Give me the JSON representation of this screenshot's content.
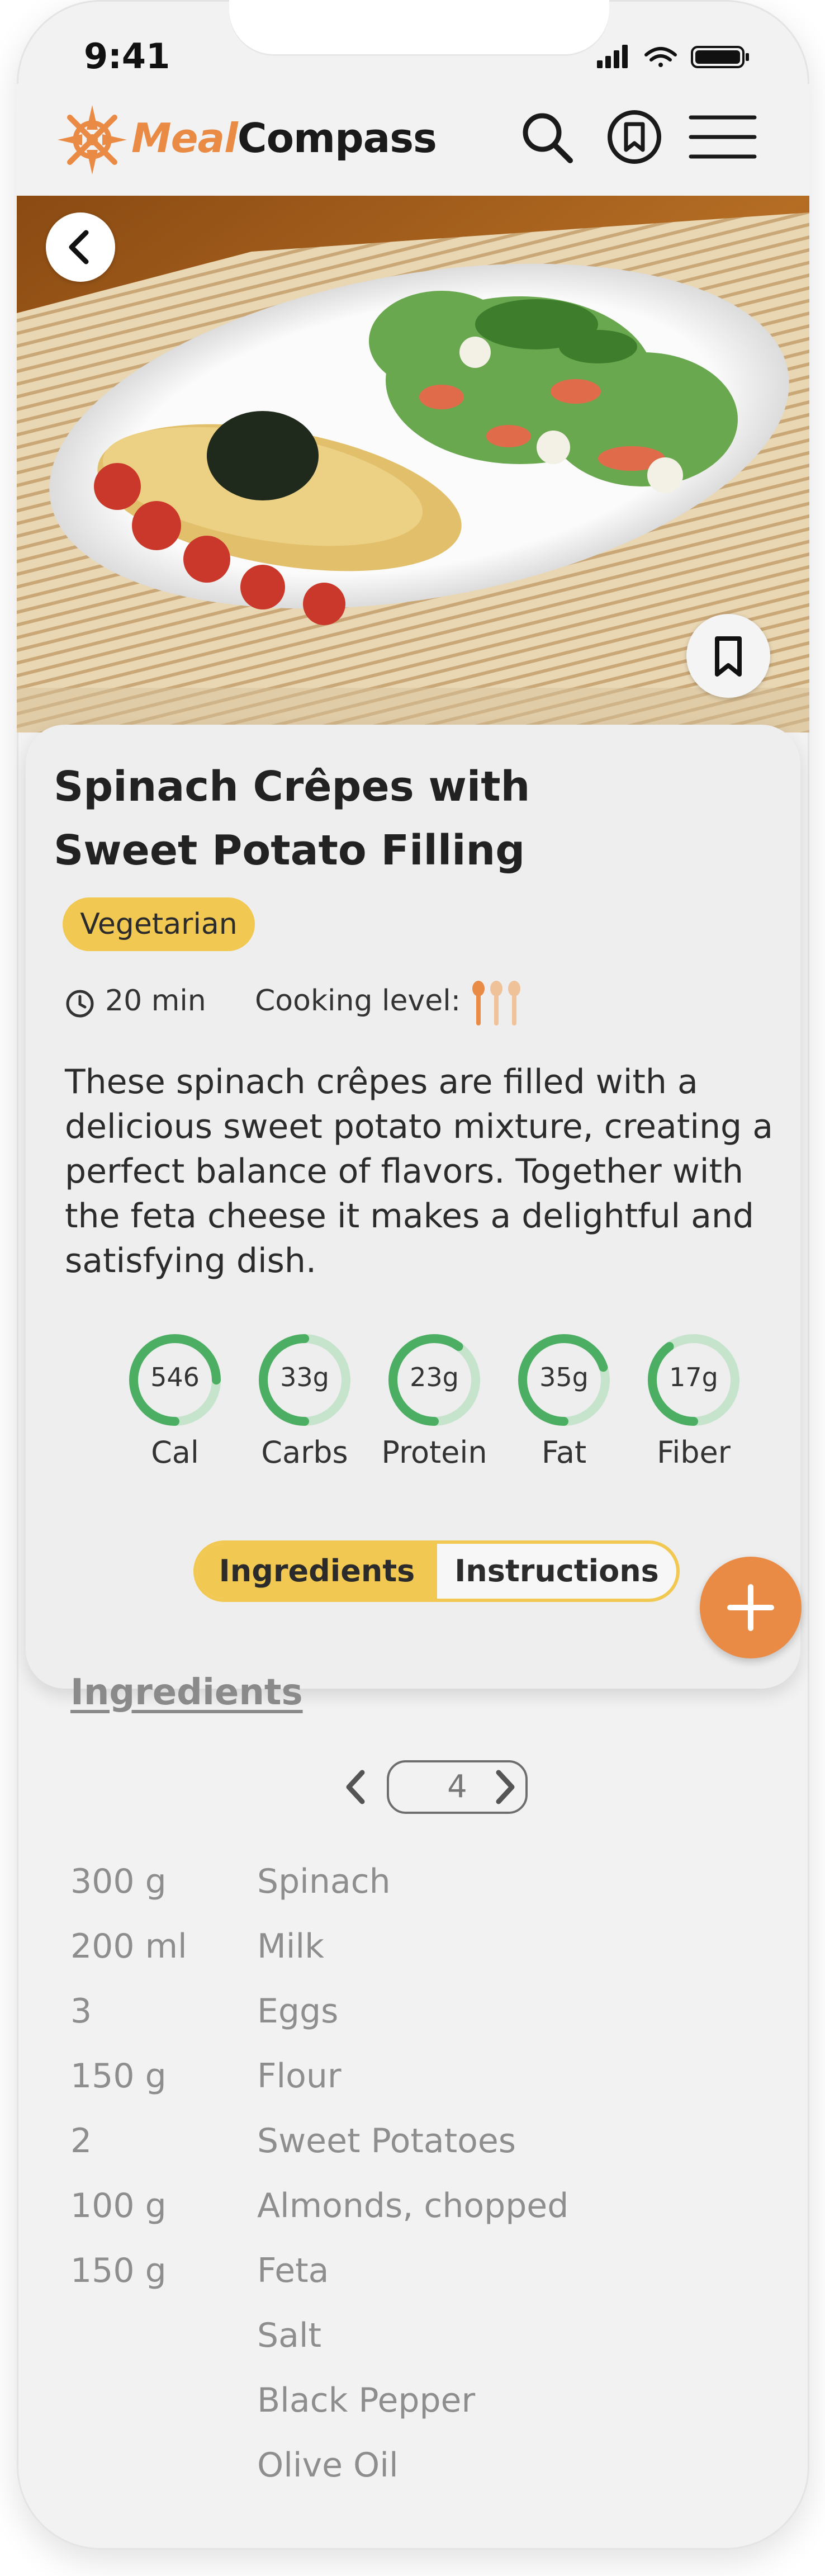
{
  "status_bar": {
    "time": "9:41"
  },
  "header": {
    "brand_part1": "Meal",
    "brand_part2": "Compass",
    "icons": [
      "search-icon",
      "bookmark-circle-icon",
      "hamburger-menu-icon"
    ]
  },
  "hero": {
    "image": "food-photo",
    "back_icon": "chevron-left-icon",
    "save_icon": "bookmark-icon"
  },
  "recipe": {
    "title_line1": "Spinach Crêpes with",
    "title_line2": "Sweet Potato Filling",
    "tag": "Vegetarian",
    "time": "20 min",
    "cooking_level_label": "Cooking level:",
    "cooking_level": {
      "filled": 1,
      "total": 3
    },
    "description": "These spinach crêpes are filled with a delicious sweet potato mixture, creating a perfect balance of flavors. Together with the feta cheese it makes a delightful and satisfying dish."
  },
  "nutrition": [
    {
      "value": "546",
      "label": "Cal",
      "fraction": 0.75
    },
    {
      "value": "33g",
      "label": "Carbs",
      "fraction": 0.5
    },
    {
      "value": "23g",
      "label": "Protein",
      "fraction": 0.6
    },
    {
      "value": "35g",
      "label": "Fat",
      "fraction": 0.7
    },
    {
      "value": "17g",
      "label": "Fiber",
      "fraction": 0.4
    }
  ],
  "tabs": {
    "active": "Ingredients",
    "inactive": "Instructions"
  },
  "fab_icon": "plus-icon",
  "ingredients": {
    "title": "Ingredients",
    "servings": "4",
    "items": [
      {
        "qty": "300 g",
        "name": "Spinach"
      },
      {
        "qty": "200 ml",
        "name": "Milk"
      },
      {
        "qty": "3",
        "name": "Eggs"
      },
      {
        "qty": "150 g",
        "name": "Flour"
      },
      {
        "qty": "2",
        "name": "Sweet Potatoes"
      },
      {
        "qty": "100 g",
        "name": "Almonds, chopped"
      },
      {
        "qty": "150 g",
        "name": "Feta"
      },
      {
        "qty": "",
        "name": "Salt"
      },
      {
        "qty": "",
        "name": "Black Pepper"
      },
      {
        "qty": "",
        "name": "Olive Oil"
      }
    ]
  },
  "colors": {
    "accent_orange": "#ea8b45",
    "accent_yellow": "#f1c852",
    "ring_green": "#4cae63",
    "ring_track": "#c6e3cc"
  }
}
